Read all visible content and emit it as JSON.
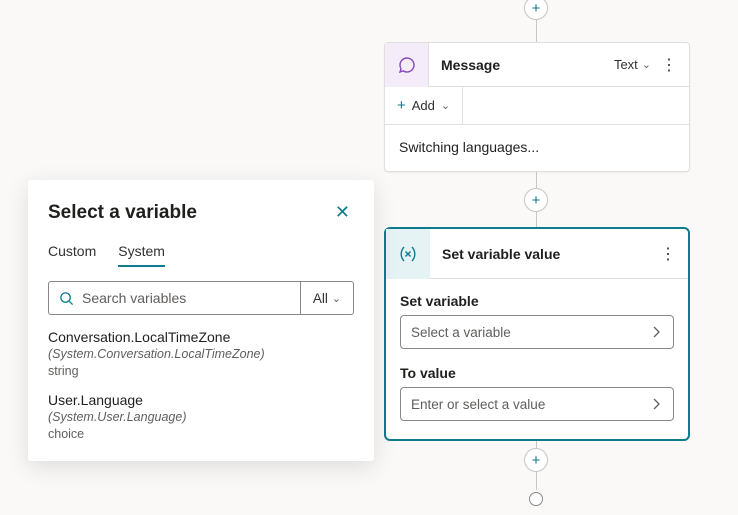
{
  "flow": {
    "plus_glyph": "+"
  },
  "message_card": {
    "title": "Message",
    "type_label": "Text",
    "add_label": "Add",
    "body_text": "Switching languages..."
  },
  "set_var_card": {
    "title": "Set variable value",
    "set_label": "Set variable",
    "set_placeholder": "Select a variable",
    "to_label": "To value",
    "to_placeholder": "Enter or select a value"
  },
  "select_panel": {
    "title": "Select a variable",
    "tabs": {
      "custom": "Custom",
      "system": "System"
    },
    "search_placeholder": "Search variables",
    "filter_label": "All",
    "items": [
      {
        "name": "Conversation.LocalTimeZone",
        "path": "(System.Conversation.LocalTimeZone)",
        "type": "string"
      },
      {
        "name": "User.Language",
        "path": "(System.User.Language)",
        "type": "choice"
      }
    ]
  }
}
